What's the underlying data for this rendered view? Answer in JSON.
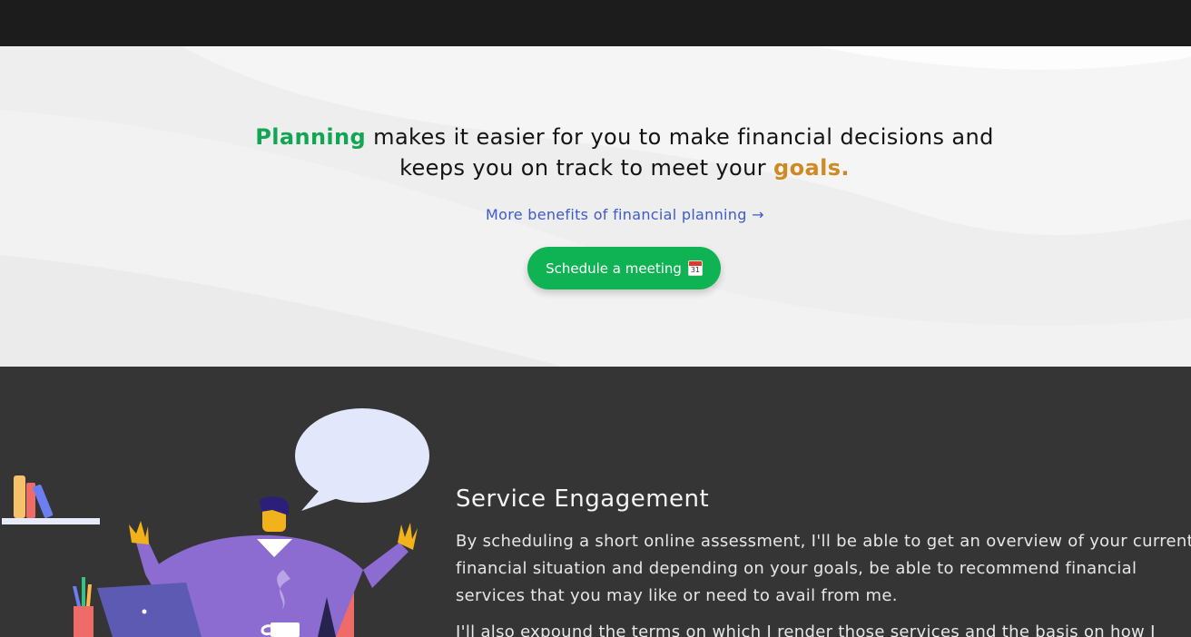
{
  "hero": {
    "lead_highlight": "Planning",
    "lead_text": " makes it easier for you to make financial decisions and",
    "line2_text": "keeps you on track to meet your ",
    "goal_highlight": "goals.",
    "benefits_link": "More benefits of financial planning →",
    "cta_label": "Schedule a meeting",
    "cta_icon": "calendar-icon",
    "cta_icon_day": "31"
  },
  "service": {
    "title": "Service Engagement",
    "paragraph1_lines": [
      "By scheduling a short online assessment, I'll be able to get an overview of your current",
      "financial situation and depending on your goals, be able to recommend financial",
      "services that you may like or need to avail from me."
    ],
    "paragraph2_line1": "I'll also expound the terms on which I render those services and the basis on how I"
  },
  "colors": {
    "accent_green": "#0fb353",
    "highlight_green": "#11a653",
    "highlight_gold": "#cf8a24",
    "link_blue": "#3d5bc9",
    "dark_section": "#353535",
    "topbar": "#1c1c1c"
  }
}
